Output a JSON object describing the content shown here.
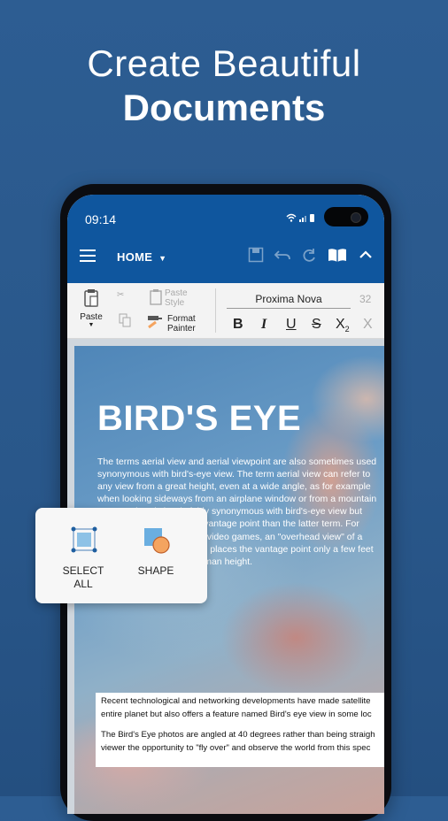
{
  "headline": {
    "line1": "Create Beautiful",
    "line2": "Documents"
  },
  "status": {
    "time": "09:14"
  },
  "appbar": {
    "menu_label": "HOME"
  },
  "ribbon": {
    "paste_label": "Paste",
    "paste_style_line1": "Paste",
    "paste_style_line2": "Style",
    "format_painter_line1": "Format",
    "format_painter_line2": "Painter",
    "font_name": "Proxima Nova",
    "font_size": "32",
    "bold": "B",
    "italic": "I",
    "underline": "U",
    "strike": "S",
    "subscript": "X",
    "subscript_mark": "2",
    "superscript": "X"
  },
  "document": {
    "title": "BIRD'S EYE",
    "body": "The terms aerial view and aerial viewpoint are also sometimes used synonymous with bird's-eye view. The term aerial view can refer to any view from a great height, even at a wide angle, as for example when looking sideways from an airplane window or from a mountain top. Overhead view is fairly synonymous with bird's-eye view but tends to imply a less lofty vantage point than the latter term. For example, in computer and video games, an \"overhead view\" of a character or situation often places the vantage point only a few feet (a meter or two) above human height.",
    "caption_p1_line1": "Recent technological and networking developments have made satellite",
    "caption_p1_line2": "entire planet but also offers a feature named Bird's eye view in some loc",
    "caption_p2_line1": "The Bird's Eye photos are angled at 40 degrees rather than being straigh",
    "caption_p2_line2": "viewer the opportunity to \"fly over\" and observe the world from this spec"
  },
  "popup": {
    "select_all_line1": "SELECT",
    "select_all_line2": "ALL",
    "shape_label": "SHAPE"
  },
  "colors": {
    "background": "#2a5a8e",
    "appbar": "#0f569e",
    "accent_orange": "#f4a460"
  }
}
